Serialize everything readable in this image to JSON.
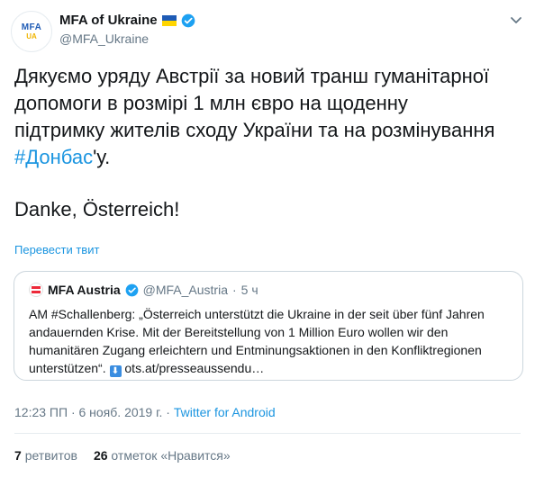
{
  "tweet": {
    "avatar_text": "MFA",
    "avatar_sub": "UA",
    "display_name": "MFA of Ukraine",
    "handle": "@MFA_Ukraine",
    "text_line1": "Дякуємо уряду Австрії за новий транш гуманітарної",
    "text_line2": "допомоги в розмірі 1 млн євро на щоденну",
    "text_line3": "підтримку жителів сходу України та на розмінування",
    "hashtag": "#Донбас",
    "hashtag_suffix": "'у.",
    "text_line5": "Danke, Österreich!",
    "translate_label": "Перевести твит"
  },
  "quoted": {
    "display_name": "MFA Austria",
    "handle": "@MFA_Austria",
    "separator": "·",
    "time": "5 ч",
    "text": "AM #Schallenberg: „Österreich unterstützt die Ukraine in der seit über fünf Jahren andauernden Krise. Mit der Bereitstellung von 1 Million Euro wollen wir den humanitären Zugang erleichtern und Entminungsaktionen in den Konfliktregionen unterstützen“.",
    "arrow": "⬇",
    "link": "ots.at/presseaussendu…"
  },
  "meta": {
    "timestamp": "12:23 ПП · 6 нояб. 2019 г. ·",
    "source": "Twitter for Android"
  },
  "stats": {
    "retweets_count": "7",
    "retweets_label": "ретвитов",
    "likes_count": "26",
    "likes_label": "отметок «Нравится»"
  },
  "colors": {
    "link": "#1b95e0",
    "verified": "#1da1f2",
    "muted": "#657786"
  },
  "icons": [
    "verified-badge-icon",
    "ukraine-flag-icon",
    "chevron-down-icon",
    "austria-flag-icon",
    "down-arrow-icon"
  ]
}
